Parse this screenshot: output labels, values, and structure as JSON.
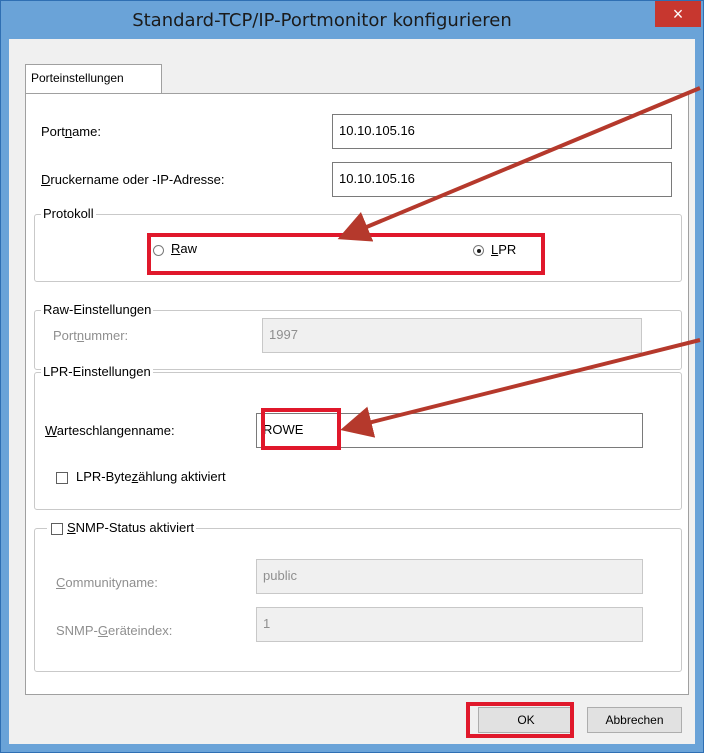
{
  "window": {
    "title": "Standard-TCP/IP-Portmonitor konfigurieren",
    "close_glyph": "×"
  },
  "tabs": [
    {
      "label": "Porteinstellungen"
    }
  ],
  "port": {
    "portname_label": "Portname:",
    "portname_value": "10.10.105.16",
    "druckername_label": "Druckername oder -IP-Adresse:",
    "druckername_value": "10.10.105.16"
  },
  "protokoll": {
    "legend": "Protokoll",
    "raw_label": "Raw",
    "lpr_label": "LPR",
    "selected": "LPR"
  },
  "raw": {
    "legend": "Raw-Einstellungen",
    "portnummer_label": "Portnummer:",
    "portnummer_value": "1997"
  },
  "lpr": {
    "legend": "LPR-Einstellungen",
    "warteschlange_label": "Warteschlangenname:",
    "warteschlange_value": "ROWE",
    "bytezaehlung_label": "LPR-Bytezählung aktiviert",
    "bytezaehlung_checked": false
  },
  "snmp": {
    "legend": "SNMP-Status aktiviert",
    "checked": false,
    "community_label": "Communityname:",
    "community_value": "public",
    "index_label": "SNMP-Geräteindex:",
    "index_value": "1"
  },
  "buttons": {
    "ok": "OK",
    "cancel": "Abbrechen"
  },
  "colors": {
    "highlight": "#e0182b",
    "arrow": "#b5392c",
    "titlebar": "#6aa3d8",
    "close": "#c7372f"
  }
}
